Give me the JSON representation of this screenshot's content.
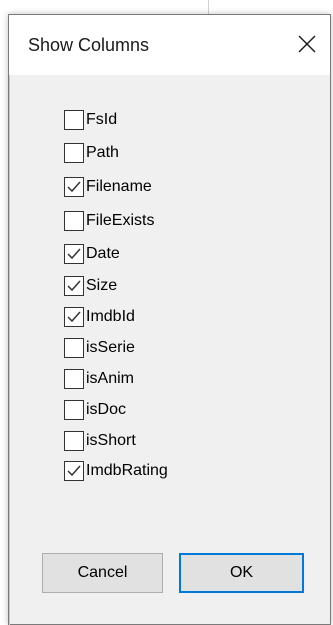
{
  "dialog": {
    "title": "Show Columns",
    "close_icon": "close-icon"
  },
  "columns": [
    {
      "label": "FsId",
      "checked": false
    },
    {
      "label": "Path",
      "checked": false
    },
    {
      "label": "Filename",
      "checked": true
    },
    {
      "label": "FileExists",
      "checked": false
    },
    {
      "label": "Date",
      "checked": true
    },
    {
      "label": "Size",
      "checked": true
    },
    {
      "label": "ImdbId",
      "checked": true
    },
    {
      "label": "isSerie",
      "checked": false
    },
    {
      "label": "isAnim",
      "checked": false
    },
    {
      "label": "isDoc",
      "checked": false
    },
    {
      "label": "isShort",
      "checked": false
    },
    {
      "label": "ImdbRating",
      "checked": true
    }
  ],
  "buttons": {
    "cancel_label": "Cancel",
    "ok_label": "OK"
  },
  "colors": {
    "accent": "#0078d7",
    "dialog_bg": "#f0f0f0",
    "titlebar_bg": "#ffffff"
  }
}
